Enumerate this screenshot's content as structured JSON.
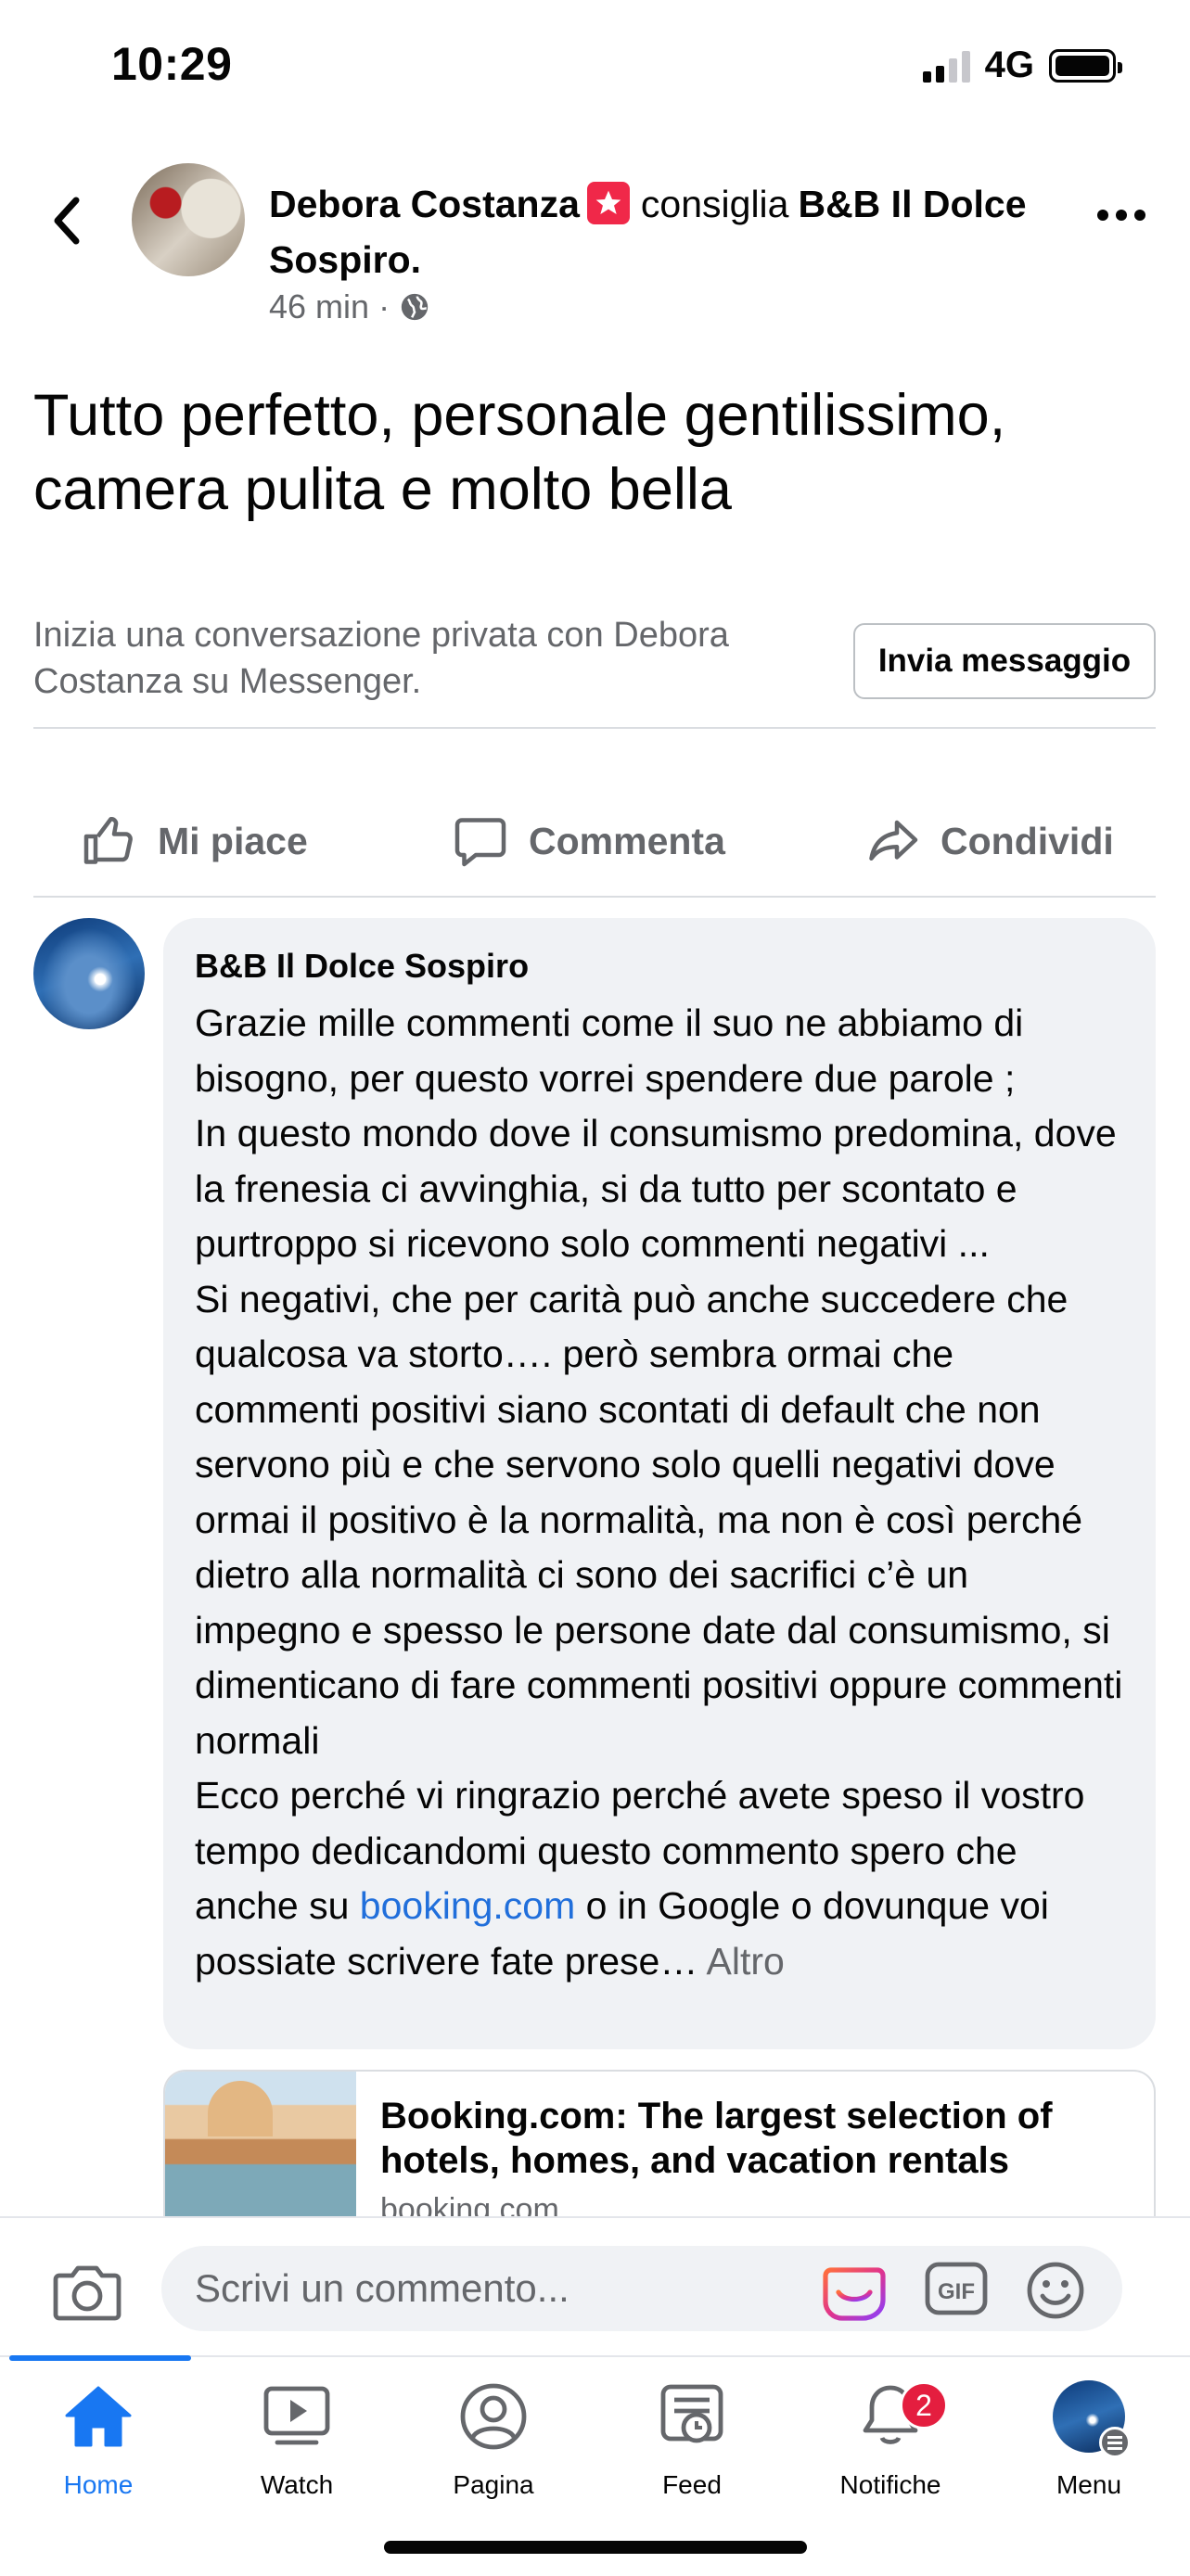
{
  "status_bar": {
    "time": "10:29",
    "network": "4G"
  },
  "post": {
    "author": "Debora Costanza",
    "verb": "consiglia",
    "page_name": "B&B Il Dolce Sospiro.",
    "time_ago": "46 min",
    "separator": "·",
    "body": "Tutto perfetto, personale gentilissimo, camera pulita e molto bella"
  },
  "messenger": {
    "prompt": "Inizia una conversazione privata con Debora Costanza su Messenger.",
    "button_label": "Invia messaggio"
  },
  "actions": {
    "like": "Mi piace",
    "comment": "Commenta",
    "share": "Condividi"
  },
  "comment": {
    "author": "B&B Il Dolce Sospiro",
    "text_before_link": "Grazie mille commenti come il suo ne abbiamo di bisogno, per questo vorrei spendere due parole ;\nIn questo mondo dove il consumismo predomina, dove la frenesia ci avvinghia, si da tutto per scontato e purtroppo si ricevono solo commenti negativi ...\nSi negativi, che per carità può anche succedere che qualcosa va storto…. però sembra ormai che commenti positivi siano scontati di default che non servono più e che servono solo quelli negativi dove ormai il positivo è la normalità, ma non è così perché dietro alla normalità ci sono dei sacrifici c’è un impegno e spesso le persone date dal consumismo, si dimenticano di fare commenti positivi oppure commenti normali\nEcco perché vi ringrazio perché avete speso il vostro tempo dedicandomi questo commento spero che anche su ",
    "link_text": "booking.com",
    "text_after_link": " o in Google o dovunque voi possiate scrivere fate prese…",
    "more_label": " Altro"
  },
  "link_preview": {
    "title": "Booking.com: The largest selection of hotels, homes, and vacation rentals",
    "domain": "booking.com"
  },
  "composer": {
    "placeholder": "Scrivi un commento..."
  },
  "bottom_nav": {
    "items": [
      {
        "label": "Home",
        "icon": "home-icon"
      },
      {
        "label": "Watch",
        "icon": "watch-icon"
      },
      {
        "label": "Pagina",
        "icon": "profile-icon"
      },
      {
        "label": "Feed",
        "icon": "feed-icon"
      },
      {
        "label": "Notifiche",
        "icon": "bell-icon",
        "badge": "2"
      },
      {
        "label": "Menu",
        "icon": "menu-avatar"
      }
    ]
  },
  "colors": {
    "accent": "#1877f2",
    "link": "#216fdb",
    "badge": "#e41e3f",
    "secondary_text": "#65676b",
    "bubble": "#f0f2f5"
  }
}
